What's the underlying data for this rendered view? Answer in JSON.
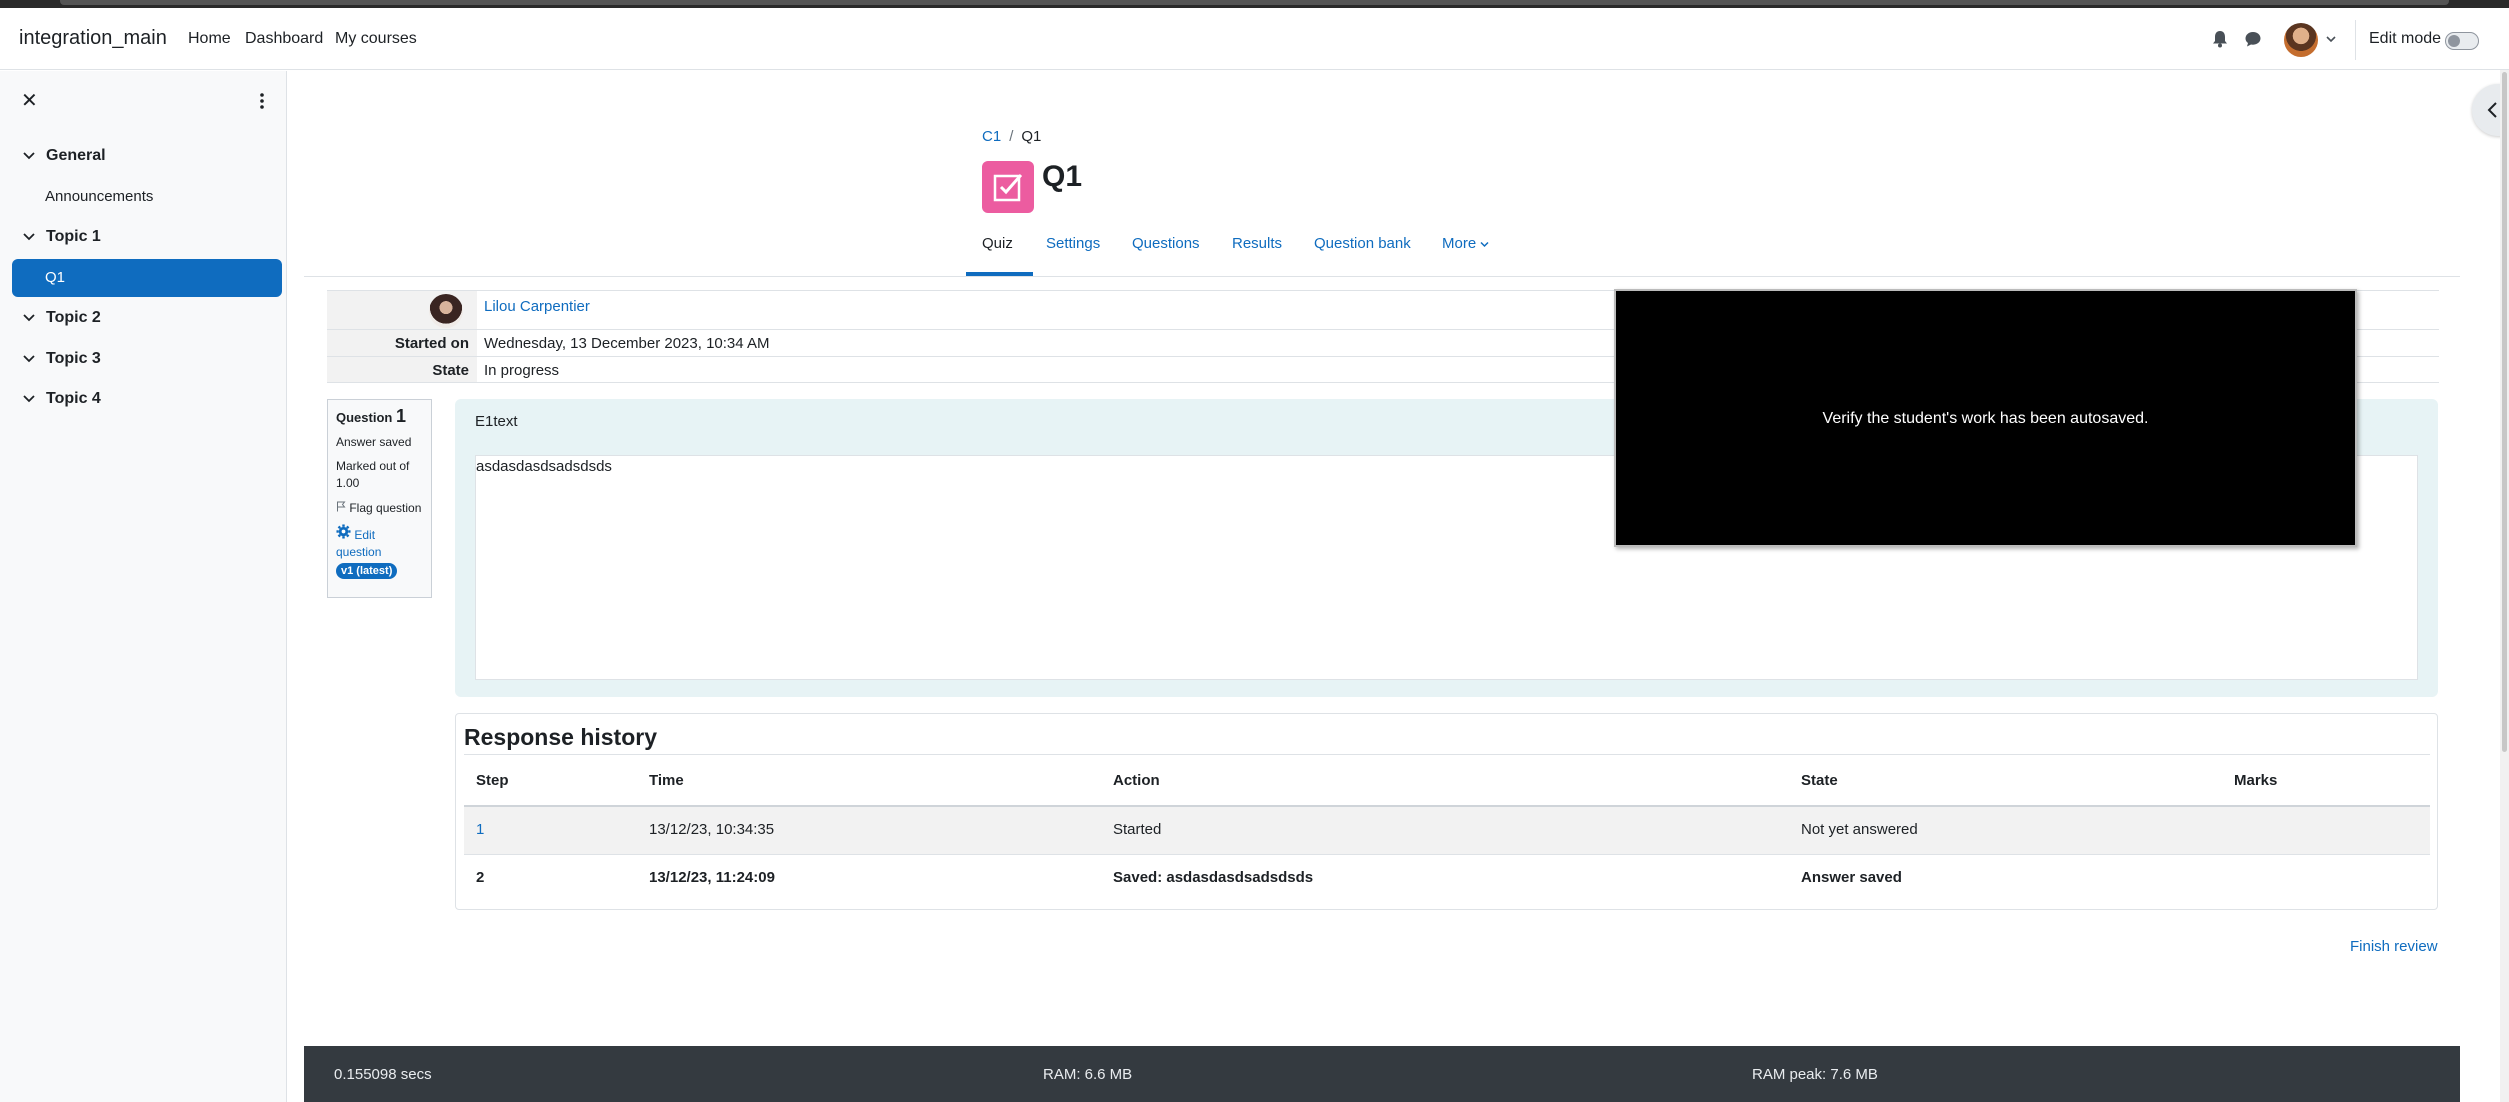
{
  "navbar": {
    "brand": "integration_main",
    "links": [
      "Home",
      "Dashboard",
      "My courses"
    ],
    "edit_mode_label": "Edit mode"
  },
  "drawer": {
    "sections": [
      {
        "title": "General",
        "items": [
          "Announcements"
        ]
      },
      {
        "title": "Topic 1",
        "items": [
          "Q1"
        ]
      },
      {
        "title": "Topic 2",
        "items": []
      },
      {
        "title": "Topic 3",
        "items": []
      },
      {
        "title": "Topic 4",
        "items": []
      }
    ],
    "active_item": "Q1"
  },
  "breadcrumb": {
    "course": "C1",
    "separator": "/",
    "current": "Q1"
  },
  "page": {
    "title": "Q1",
    "icon_color": "#ec5ca0"
  },
  "tabs": [
    "Quiz",
    "Settings",
    "Questions",
    "Results",
    "Question bank",
    "More"
  ],
  "active_tab": "Quiz",
  "summary": {
    "user_name": "Lilou Carpentier",
    "started_on_label": "Started on",
    "started_on": "Wednesday, 13 December 2023, 10:34 AM",
    "state_label": "State",
    "state": "In progress"
  },
  "question_info": {
    "question_label": "Question",
    "number": "1",
    "status": "Answer saved",
    "marked": "Marked out of 1.00",
    "flag": "Flag question",
    "edit": "Edit question",
    "version_badge": "v1 (latest)"
  },
  "question": {
    "text": "E1text",
    "answer": "asdasdasdsadsdsds"
  },
  "overlay": {
    "message": "Verify the student's work has been autosaved."
  },
  "history": {
    "title": "Response history",
    "columns": [
      "Step",
      "Time",
      "Action",
      "State",
      "Marks"
    ],
    "rows": [
      {
        "step": "1",
        "time": "13/12/23, 10:34:35",
        "action": "Started",
        "state": "Not yet answered",
        "marks": ""
      },
      {
        "step": "2",
        "time": "13/12/23, 11:24:09",
        "action": "Saved: asdasdasdsadsdsds",
        "state": "Answer saved",
        "marks": ""
      }
    ]
  },
  "finish_review": "Finish review",
  "footer": {
    "time": "0.155098 secs",
    "ram": "RAM: 6.6 MB",
    "ram_peak": "RAM peak: 7.6 MB"
  },
  "colors": {
    "primary": "#0f6cbf",
    "footer_bg": "#343a40",
    "question_bg": "#e7f3f5"
  }
}
